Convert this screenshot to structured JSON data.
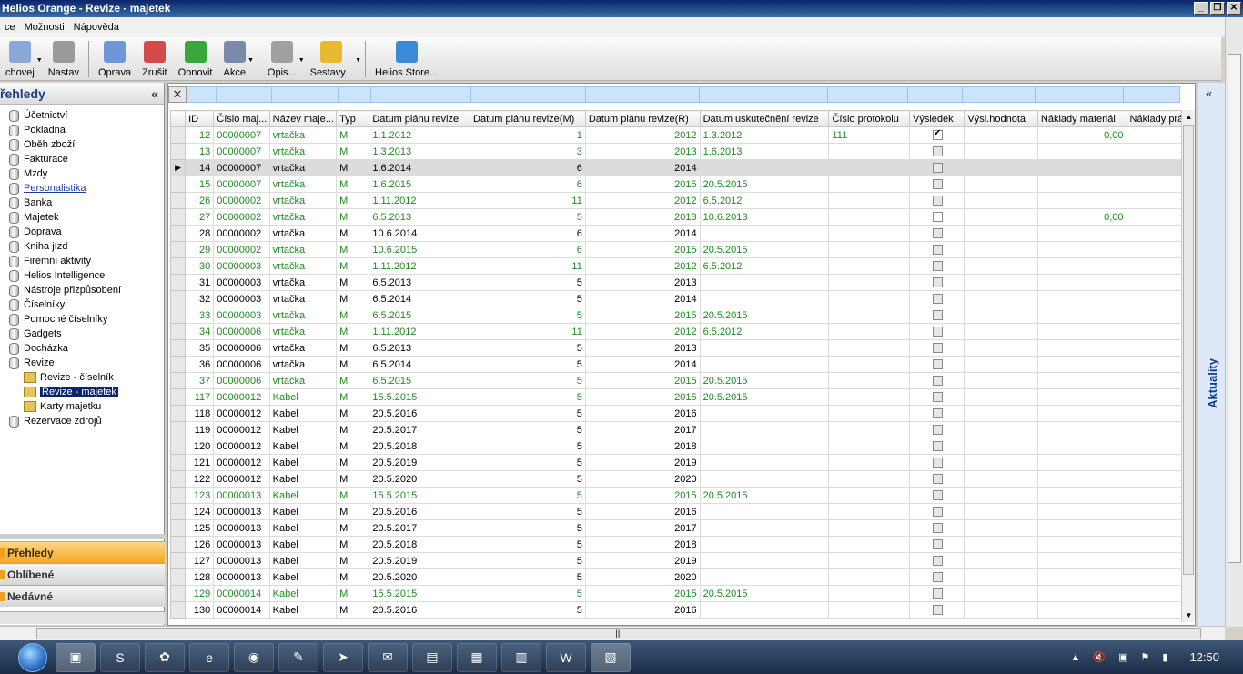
{
  "window": {
    "title": "Helios Orange - Revize - majetek",
    "buttons": [
      "_",
      "❐",
      "✕"
    ]
  },
  "menu": [
    "ce",
    "Možnosti",
    "Nápověda"
  ],
  "toolbar": [
    {
      "label": "chovej",
      "icon": "window-arrow-icon",
      "drop": true
    },
    {
      "label": "Nastav",
      "icon": "settings-icon",
      "drop": false
    },
    {
      "label": "Oprava",
      "icon": "edit-icon",
      "drop": false
    },
    {
      "label": "Zrušit",
      "icon": "delete-icon",
      "drop": false
    },
    {
      "label": "Obnovit",
      "icon": "refresh-icon",
      "drop": false
    },
    {
      "label": "Akce",
      "icon": "action-icon",
      "drop": true
    },
    {
      "label": "Opis...",
      "icon": "printer-icon",
      "drop": true
    },
    {
      "label": "Sestavy...",
      "icon": "folder-icon",
      "drop": true
    },
    {
      "label": "Helios Store...",
      "icon": "globe-icon",
      "drop": false
    }
  ],
  "left_panel": {
    "title": "řehledy",
    "collapse": "«",
    "tree": [
      {
        "label": "Účetnictví",
        "type": "db"
      },
      {
        "label": "Pokladna",
        "type": "db"
      },
      {
        "label": "Oběh zboží",
        "type": "db"
      },
      {
        "label": "Fakturace",
        "type": "db"
      },
      {
        "label": "Mzdy",
        "type": "db"
      },
      {
        "label": "Personalistika",
        "type": "db",
        "link": true
      },
      {
        "label": "Banka",
        "type": "db"
      },
      {
        "label": "Majetek",
        "type": "db"
      },
      {
        "label": "Doprava",
        "type": "db"
      },
      {
        "label": "Kniha jízd",
        "type": "db"
      },
      {
        "label": "Firemní aktivity",
        "type": "db"
      },
      {
        "label": "Helios Intelligence",
        "type": "db"
      },
      {
        "label": "Nástroje přizpůsobení",
        "type": "db"
      },
      {
        "label": "Číselníky",
        "type": "db"
      },
      {
        "label": "Pomocné číselníky",
        "type": "db"
      },
      {
        "label": "Gadgets",
        "type": "db"
      },
      {
        "label": "Docházka",
        "type": "db"
      },
      {
        "label": "Revize",
        "type": "db"
      },
      {
        "label": "Revize - číselník",
        "type": "folder"
      },
      {
        "label": "Revize - majetek",
        "type": "folder",
        "selected": true
      },
      {
        "label": "Karty majetku",
        "type": "folder"
      },
      {
        "label": "Rezervace zdrojů",
        "type": "db"
      }
    ],
    "nav": [
      {
        "label": "Přehledy",
        "active": true
      },
      {
        "label": "Oblíbené",
        "active": false
      },
      {
        "label": "Nedávné",
        "active": false
      }
    ]
  },
  "grid": {
    "filter_clear": "✕",
    "columns": [
      "ID",
      "Číslo maj...",
      "Název maje...",
      "Typ",
      "Datum plánu revize",
      "Datum plánu revize(M)",
      "Datum plánu revize(R)",
      "Datum uskutečnění revize",
      "Číslo protokolu",
      "Výsledek",
      "Výsl.hodnota",
      "Náklady materiál",
      "Náklady prá"
    ],
    "rows": [
      {
        "id": "12",
        "cislo": "00000007",
        "nazev": "vrtačka",
        "typ": "M",
        "datum": "1.1.2012",
        "m": "1",
        "r": "2012",
        "usk": "1.3.2012",
        "protokol": "111",
        "vysledek": "checked",
        "hodnota": "",
        "material": "0,00",
        "green": true
      },
      {
        "id": "13",
        "cislo": "00000007",
        "nazev": "vrtačka",
        "typ": "M",
        "datum": "1.3.2013",
        "m": "3",
        "r": "2013",
        "usk": "1.6.2013",
        "protokol": "",
        "vysledek": "grey",
        "hodnota": "",
        "material": "",
        "green": true
      },
      {
        "id": "14",
        "cislo": "00000007",
        "nazev": "vrtačka",
        "typ": "M",
        "datum": "1.6.2014",
        "m": "6",
        "r": "2014",
        "usk": "",
        "protokol": "",
        "vysledek": "grey",
        "hodnota": "",
        "material": "",
        "green": false,
        "current": true
      },
      {
        "id": "15",
        "cislo": "00000007",
        "nazev": "vrtačka",
        "typ": "M",
        "datum": "1.6.2015",
        "m": "6",
        "r": "2015",
        "usk": "20.5.2015",
        "protokol": "",
        "vysledek": "grey",
        "hodnota": "",
        "material": "",
        "green": true
      },
      {
        "id": "26",
        "cislo": "00000002",
        "nazev": "vrtačka",
        "typ": "M",
        "datum": "1.11.2012",
        "m": "11",
        "r": "2012",
        "usk": "6.5.2012",
        "protokol": "",
        "vysledek": "grey",
        "hodnota": "",
        "material": "",
        "green": true
      },
      {
        "id": "27",
        "cislo": "00000002",
        "nazev": "vrtačka",
        "typ": "M",
        "datum": "6.5.2013",
        "m": "5",
        "r": "2013",
        "usk": "10.6.2013",
        "protokol": "",
        "vysledek": "white",
        "hodnota": "",
        "material": "0,00",
        "green": true
      },
      {
        "id": "28",
        "cislo": "00000002",
        "nazev": "vrtačka",
        "typ": "M",
        "datum": "10.6.2014",
        "m": "6",
        "r": "2014",
        "usk": "",
        "protokol": "",
        "vysledek": "grey",
        "hodnota": "",
        "material": "",
        "green": false
      },
      {
        "id": "29",
        "cislo": "00000002",
        "nazev": "vrtačka",
        "typ": "M",
        "datum": "10.6.2015",
        "m": "6",
        "r": "2015",
        "usk": "20.5.2015",
        "protokol": "",
        "vysledek": "grey",
        "hodnota": "",
        "material": "",
        "green": true
      },
      {
        "id": "30",
        "cislo": "00000003",
        "nazev": "vrtačka",
        "typ": "M",
        "datum": "1.11.2012",
        "m": "11",
        "r": "2012",
        "usk": "6.5.2012",
        "protokol": "",
        "vysledek": "grey",
        "hodnota": "",
        "material": "",
        "green": true
      },
      {
        "id": "31",
        "cislo": "00000003",
        "nazev": "vrtačka",
        "typ": "M",
        "datum": "6.5.2013",
        "m": "5",
        "r": "2013",
        "usk": "",
        "protokol": "",
        "vysledek": "grey",
        "hodnota": "",
        "material": "",
        "green": false
      },
      {
        "id": "32",
        "cislo": "00000003",
        "nazev": "vrtačka",
        "typ": "M",
        "datum": "6.5.2014",
        "m": "5",
        "r": "2014",
        "usk": "",
        "protokol": "",
        "vysledek": "grey",
        "hodnota": "",
        "material": "",
        "green": false
      },
      {
        "id": "33",
        "cislo": "00000003",
        "nazev": "vrtačka",
        "typ": "M",
        "datum": "6.5.2015",
        "m": "5",
        "r": "2015",
        "usk": "20.5.2015",
        "protokol": "",
        "vysledek": "grey",
        "hodnota": "",
        "material": "",
        "green": true
      },
      {
        "id": "34",
        "cislo": "00000006",
        "nazev": "vrtačka",
        "typ": "M",
        "datum": "1.11.2012",
        "m": "11",
        "r": "2012",
        "usk": "6.5.2012",
        "protokol": "",
        "vysledek": "grey",
        "hodnota": "",
        "material": "",
        "green": true
      },
      {
        "id": "35",
        "cislo": "00000006",
        "nazev": "vrtačka",
        "typ": "M",
        "datum": "6.5.2013",
        "m": "5",
        "r": "2013",
        "usk": "",
        "protokol": "",
        "vysledek": "grey",
        "hodnota": "",
        "material": "",
        "green": false
      },
      {
        "id": "36",
        "cislo": "00000006",
        "nazev": "vrtačka",
        "typ": "M",
        "datum": "6.5.2014",
        "m": "5",
        "r": "2014",
        "usk": "",
        "protokol": "",
        "vysledek": "grey",
        "hodnota": "",
        "material": "",
        "green": false
      },
      {
        "id": "37",
        "cislo": "00000006",
        "nazev": "vrtačka",
        "typ": "M",
        "datum": "6.5.2015",
        "m": "5",
        "r": "2015",
        "usk": "20.5.2015",
        "protokol": "",
        "vysledek": "grey",
        "hodnota": "",
        "material": "",
        "green": true
      },
      {
        "id": "117",
        "cislo": "00000012",
        "nazev": "Kabel",
        "typ": "M",
        "datum": "15.5.2015",
        "m": "5",
        "r": "2015",
        "usk": "20.5.2015",
        "protokol": "",
        "vysledek": "grey",
        "hodnota": "",
        "material": "",
        "green": true
      },
      {
        "id": "118",
        "cislo": "00000012",
        "nazev": "Kabel",
        "typ": "M",
        "datum": "20.5.2016",
        "m": "5",
        "r": "2016",
        "usk": "",
        "protokol": "",
        "vysledek": "grey",
        "hodnota": "",
        "material": "",
        "green": false
      },
      {
        "id": "119",
        "cislo": "00000012",
        "nazev": "Kabel",
        "typ": "M",
        "datum": "20.5.2017",
        "m": "5",
        "r": "2017",
        "usk": "",
        "protokol": "",
        "vysledek": "grey",
        "hodnota": "",
        "material": "",
        "green": false
      },
      {
        "id": "120",
        "cislo": "00000012",
        "nazev": "Kabel",
        "typ": "M",
        "datum": "20.5.2018",
        "m": "5",
        "r": "2018",
        "usk": "",
        "protokol": "",
        "vysledek": "grey",
        "hodnota": "",
        "material": "",
        "green": false
      },
      {
        "id": "121",
        "cislo": "00000012",
        "nazev": "Kabel",
        "typ": "M",
        "datum": "20.5.2019",
        "m": "5",
        "r": "2019",
        "usk": "",
        "protokol": "",
        "vysledek": "grey",
        "hodnota": "",
        "material": "",
        "green": false
      },
      {
        "id": "122",
        "cislo": "00000012",
        "nazev": "Kabel",
        "typ": "M",
        "datum": "20.5.2020",
        "m": "5",
        "r": "2020",
        "usk": "",
        "protokol": "",
        "vysledek": "grey",
        "hodnota": "",
        "material": "",
        "green": false
      },
      {
        "id": "123",
        "cislo": "00000013",
        "nazev": "Kabel",
        "typ": "M",
        "datum": "15.5.2015",
        "m": "5",
        "r": "2015",
        "usk": "20.5.2015",
        "protokol": "",
        "vysledek": "grey",
        "hodnota": "",
        "material": "",
        "green": true
      },
      {
        "id": "124",
        "cislo": "00000013",
        "nazev": "Kabel",
        "typ": "M",
        "datum": "20.5.2016",
        "m": "5",
        "r": "2016",
        "usk": "",
        "protokol": "",
        "vysledek": "grey",
        "hodnota": "",
        "material": "",
        "green": false
      },
      {
        "id": "125",
        "cislo": "00000013",
        "nazev": "Kabel",
        "typ": "M",
        "datum": "20.5.2017",
        "m": "5",
        "r": "2017",
        "usk": "",
        "protokol": "",
        "vysledek": "grey",
        "hodnota": "",
        "material": "",
        "green": false
      },
      {
        "id": "126",
        "cislo": "00000013",
        "nazev": "Kabel",
        "typ": "M",
        "datum": "20.5.2018",
        "m": "5",
        "r": "2018",
        "usk": "",
        "protokol": "",
        "vysledek": "grey",
        "hodnota": "",
        "material": "",
        "green": false
      },
      {
        "id": "127",
        "cislo": "00000013",
        "nazev": "Kabel",
        "typ": "M",
        "datum": "20.5.2019",
        "m": "5",
        "r": "2019",
        "usk": "",
        "protokol": "",
        "vysledek": "grey",
        "hodnota": "",
        "material": "",
        "green": false
      },
      {
        "id": "128",
        "cislo": "00000013",
        "nazev": "Kabel",
        "typ": "M",
        "datum": "20.5.2020",
        "m": "5",
        "r": "2020",
        "usk": "",
        "protokol": "",
        "vysledek": "grey",
        "hodnota": "",
        "material": "",
        "green": false
      },
      {
        "id": "129",
        "cislo": "00000014",
        "nazev": "Kabel",
        "typ": "M",
        "datum": "15.5.2015",
        "m": "5",
        "r": "2015",
        "usk": "20.5.2015",
        "protokol": "",
        "vysledek": "grey",
        "hodnota": "",
        "material": "",
        "green": true
      },
      {
        "id": "130",
        "cislo": "00000014",
        "nazev": "Kabel",
        "typ": "M",
        "datum": "20.5.2016",
        "m": "5",
        "r": "2016",
        "usk": "",
        "protokol": "",
        "vysledek": "grey",
        "hodnota": "",
        "material": "",
        "green": false
      }
    ]
  },
  "right_panel": {
    "collapse": "«",
    "tab": "Aktuality"
  },
  "taskbar": {
    "apps": [
      "helios-app-icon",
      "skype-icon",
      "flower-icon",
      "ie-icon",
      "chrome-icon",
      "paint-icon",
      "arrow-app-icon",
      "outlook-icon",
      "folder-app-icon",
      "explorer-icon",
      "calculator-icon",
      "word-icon",
      "network-app-icon"
    ],
    "clock": "12:50"
  },
  "colors": {
    "green_row": "#1f8a1f",
    "title_bar": "#0a246a",
    "filter": "#cce4fb",
    "nav_active": "#f5a623"
  }
}
